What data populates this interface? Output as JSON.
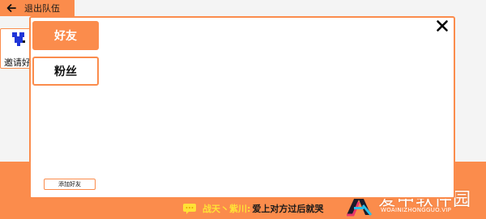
{
  "header": {
    "exit_label": "退出队伍",
    "back_icon": "arrow-left-icon"
  },
  "invite": {
    "label": "邀请好"
  },
  "modal": {
    "tabs": [
      {
        "label": "好友",
        "active": true
      },
      {
        "label": "粉丝",
        "active": false
      }
    ],
    "add_friend_label": "添加好友",
    "close_icon": "close-icon"
  },
  "ticker": {
    "user": "战天丶紫川:",
    "message": "爱上对方过后就哭"
  },
  "watermark": {
    "name": "爱中软件园",
    "url": "WOAINIZHONGGUO.VIP"
  },
  "colors": {
    "accent": "#fb8c4c",
    "ticker_user": "#ffe236",
    "background": "#f4f4f4"
  }
}
